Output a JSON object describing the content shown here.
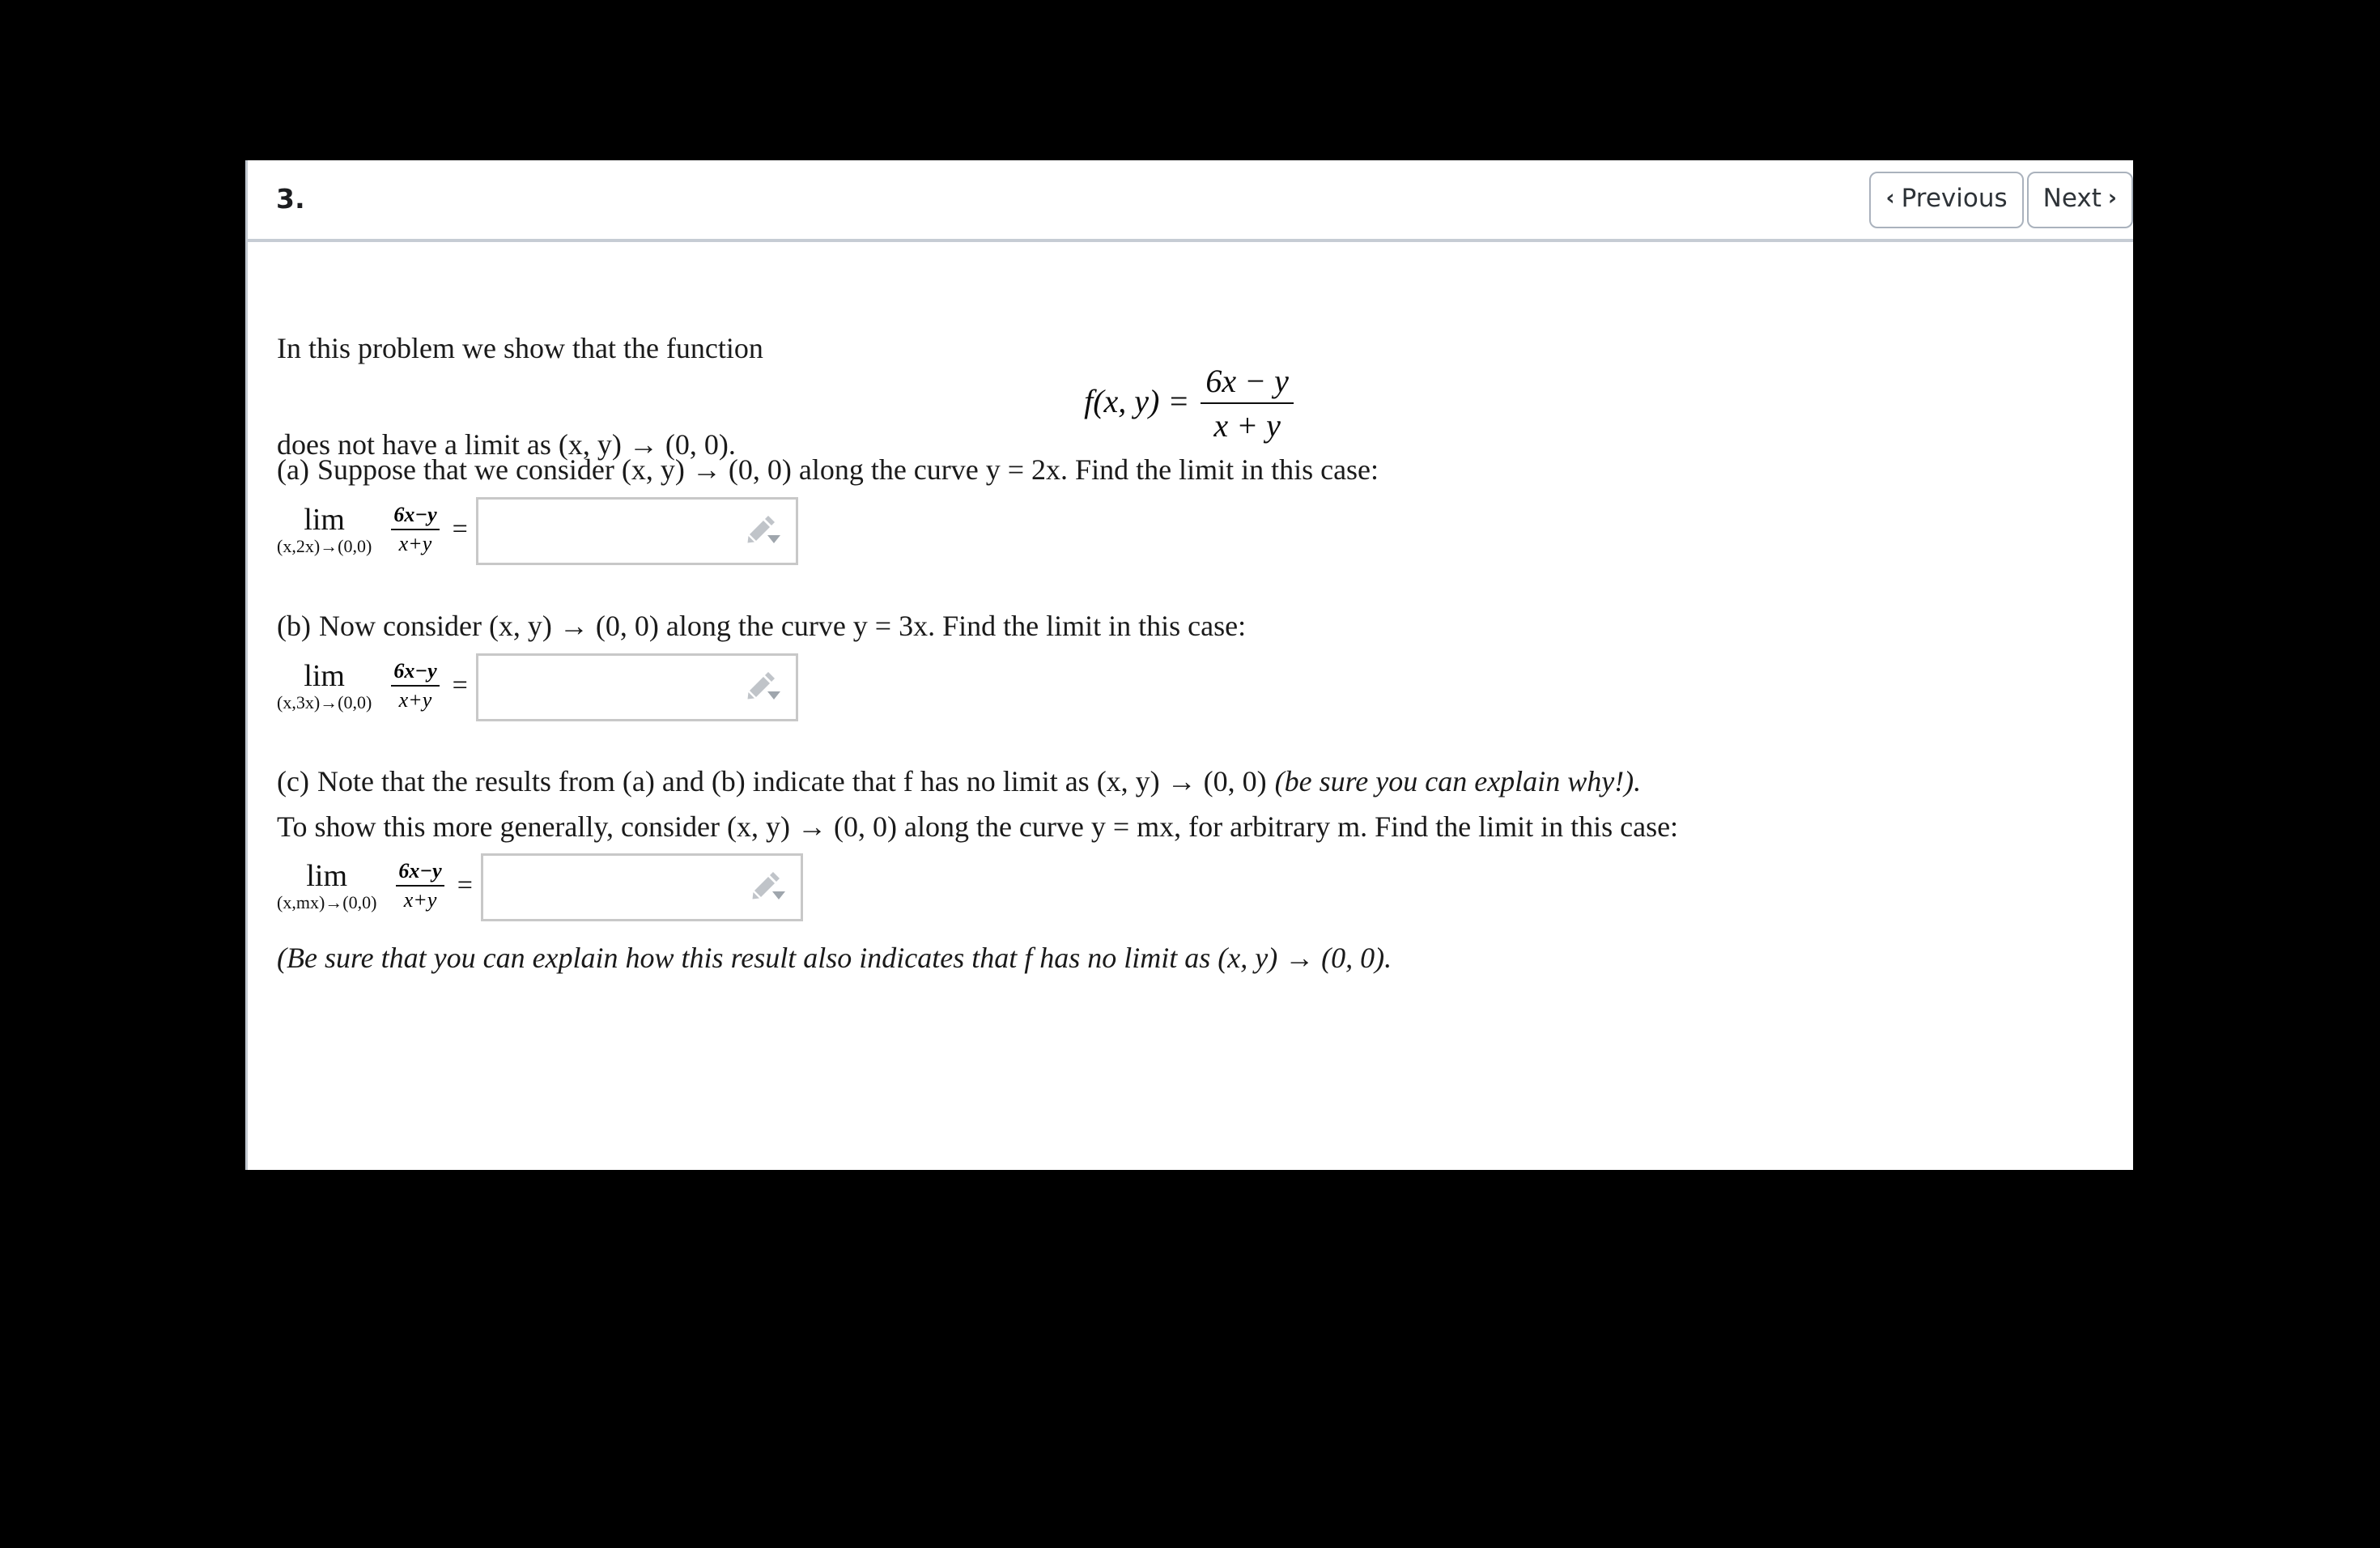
{
  "header": {
    "problem_number": "3.",
    "previous_label": "Previous",
    "next_label": "Next",
    "prev_chevron": "‹",
    "next_chevron": "›"
  },
  "problem": {
    "intro": "In this problem we show that the function",
    "function_display": {
      "lhs": "f(x, y) =",
      "numerator": "6x − y",
      "denominator": "x + y"
    },
    "after_function": "does not have a limit as (x, y) → (0, 0).",
    "parts": [
      {
        "label": "(a)",
        "prompt": "Suppose that we consider (x, y) → (0, 0) along the curve y = 2x. Find the limit in this case:",
        "limit": {
          "op": "lim",
          "subscript": "(x,2x)→(0,0)",
          "numerator": "6x−y",
          "denominator": "x+y",
          "equals": "="
        },
        "answer_value": "",
        "answer_placeholder": ""
      },
      {
        "label": "(b)",
        "prompt": "Now consider (x, y) → (0, 0) along the curve y = 3x. Find the limit in this case:",
        "limit": {
          "op": "lim",
          "subscript": "(x,3x)→(0,0)",
          "numerator": "6x−y",
          "denominator": "x+y",
          "equals": "="
        },
        "answer_value": "",
        "answer_placeholder": ""
      },
      {
        "label": "(c)",
        "prompt_line1": "Note that the results from (a) and (b) indicate that f has no limit as (x, y) → (0, 0)",
        "prompt_line1_italic": "(be sure you can explain why!).",
        "prompt_line2": "To show this more generally, consider (x, y) → (0, 0) along the curve y = mx, for arbitrary m. Find the limit in this case:",
        "limit": {
          "op": "lim",
          "subscript": "(x,mx)→(0,0)",
          "numerator": "6x−y",
          "denominator": "x+y",
          "equals": "="
        },
        "answer_value": "",
        "answer_placeholder": ""
      }
    ],
    "closing_note": "(Be sure that you can explain how this result also indicates that f has no limit as (x, y) → (0, 0)."
  },
  "icons": {
    "pencil": "pencil-icon",
    "caret": "caret-down-icon"
  },
  "colors": {
    "page_background": "#000000",
    "card_background": "#ffffff",
    "text": "#1a1a1a",
    "divider": "#c6ccd4",
    "input_border": "#c8c8c8",
    "icon_gray": "#c0c4c9",
    "button_border": "#aab2bd"
  }
}
